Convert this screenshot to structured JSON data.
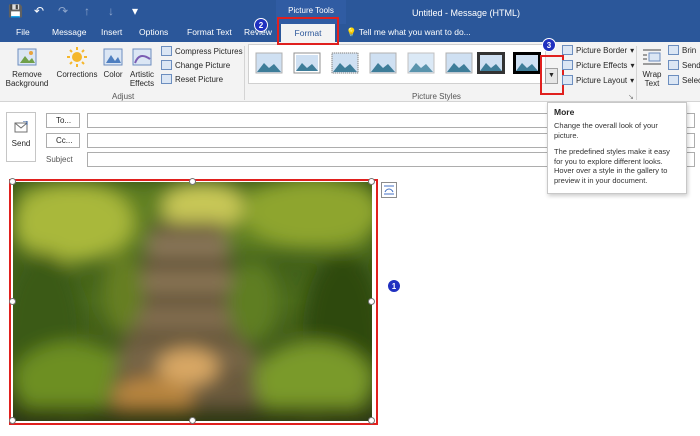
{
  "window": {
    "title": "Untitled - Message (HTML)",
    "context_group": "Picture Tools"
  },
  "quick_access": {
    "icons": [
      "save-icon",
      "undo-icon",
      "redo-icon",
      "up-icon",
      "down-icon",
      "customize-icon"
    ]
  },
  "tabs": [
    "File",
    "Message",
    "Insert",
    "Options",
    "Format Text",
    "Review",
    "Format"
  ],
  "tell_me": "Tell me what you want to do...",
  "ribbon": {
    "remove_background": "Remove Background",
    "corrections": "Corrections",
    "color": "Color",
    "artistic_effects": "Artistic Effects",
    "compress_pictures": "Compress Pictures",
    "change_picture": "Change Picture",
    "reset_picture": "Reset Picture",
    "adjust_label": "Adjust",
    "picture_styles_label": "Picture Styles",
    "picture_border": "Picture Border",
    "picture_effects": "Picture Effects",
    "picture_layout": "Picture Layout",
    "wrap_text": "Wrap Text",
    "bring": "Brin",
    "send": "Send",
    "select": "Selec"
  },
  "tooltip": {
    "title": "More",
    "line1": "Change the overall look of your picture.",
    "line2": "The predefined styles make it easy for you to explore different looks. Hover over a style in the gallery to preview it in your document."
  },
  "compose": {
    "send": "Send",
    "to": "To...",
    "cc": "Cc...",
    "subject": "Subject"
  },
  "badges": {
    "image": "1",
    "format_tab": "2",
    "more_button": "3"
  },
  "colors": {
    "accent": "#2b579a",
    "highlight": "#e0201e",
    "badge": "#2030c0"
  }
}
